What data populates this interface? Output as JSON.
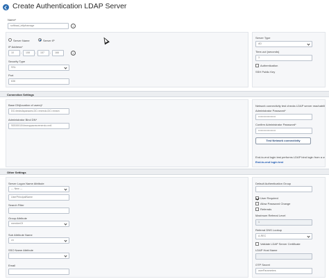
{
  "title": "Create Authentication LDAP Server",
  "basic": {
    "name_label": "Name*",
    "name_value": "softbaal_intlpframage",
    "server_name_option": "Server Name",
    "server_ip_option": "Server IP",
    "ip_label": "IP Address*",
    "ip_octets": [
      "10",
      "108",
      "157",
      "166"
    ],
    "security_type_label": "Security Type",
    "security_type_value": "SSL",
    "port_label": "Port",
    "port_value": "636",
    "server_type_label": "Server Type",
    "server_type_value": "AD",
    "timeout_label": "Time-out (seconds)",
    "timeout_value": "3",
    "authentication_label": "Authentication",
    "ssh_key_label": "SSH Public Key"
  },
  "connection": {
    "section_title": "Connection Settings",
    "base_dn_label": "Base DN(location of users)*",
    "base_dn_value": "DC=tests4sparaces,DC=enercio,DC=mnsm",
    "admin_bind_label": "Administrator Bind DN*",
    "admin_bind_value": "S0D00\\10\\4nsrxppacrsrvenercio.nn6",
    "note_text": "Network connectivity test checks LDAP server reachability",
    "admin_password_label": "Administrator Password*",
    "admin_password_value": "••••••••••••••••••••",
    "confirm_password_label": "Confirm Administrator Password*",
    "confirm_password_value": "••••••••••••••••••••",
    "test_button": "Test Network connectivity",
    "end_note": "End-to-end login test performs LDAP bind login from a user",
    "end_link": "End-to-end login test"
  },
  "other": {
    "section_title": "Other Settings",
    "logon_attr_label": "Server Logon Name Attribute",
    "logon_attr_value": "--- New ---",
    "logon_attr_input": "UserPrincipalName",
    "search_filter_label": "Search Filter",
    "group_attr_label": "Group Attribute",
    "group_attr_value": "memberOf",
    "sub_attr_label": "Sub Attribute Name",
    "sub_attr_value": "cn",
    "sso_attr_label": "SSO Name Attribute",
    "email_label": "Email",
    "default_group_label": "Default Authentication Group",
    "user_required_label": "User Required",
    "allow_pw_change_label": "Allow Password Change",
    "referrals_label": "Referrals",
    "max_referral_label": "Maximum Referral Level",
    "max_referral_value": "1",
    "referral_dns_label": "Referral DNS Lookup",
    "referral_dns_value": "A-REC",
    "validate_cert_label": "Validate LDAP Server Certificate",
    "ldap_host_label": "LDAP Host Name",
    "otp_secret_label": "OTP Secret",
    "otp_secret_value": "userParameters"
  }
}
